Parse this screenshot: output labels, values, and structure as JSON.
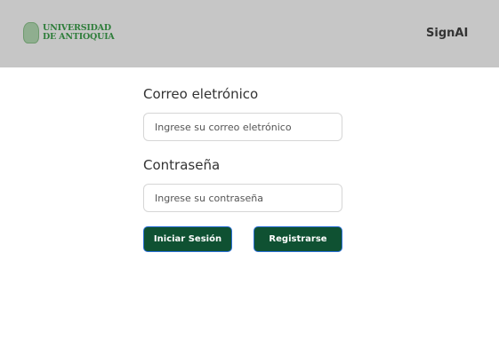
{
  "header": {
    "logo_line1": "UNIVERSIDAD",
    "logo_line2": "DE ANTIOQUIA",
    "brand": "SignAI"
  },
  "form": {
    "email_label": "Correo eletrónico",
    "email_placeholder": "Ingrese su correo eletrónico",
    "email_value": "",
    "password_label": "Contraseña",
    "password_placeholder": "Ingrese su contraseña",
    "password_value": "",
    "login_label": "Iniciar Sesión",
    "register_label": "Registrarse"
  }
}
